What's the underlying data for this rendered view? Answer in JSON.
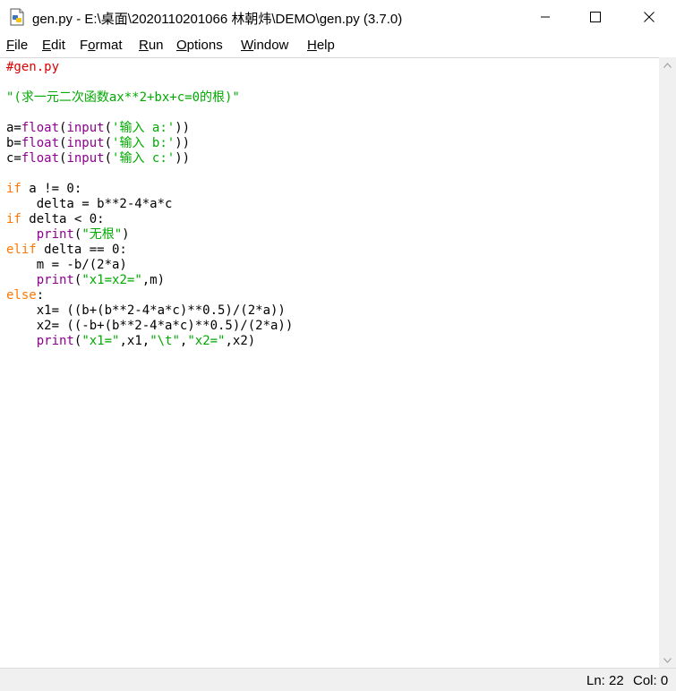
{
  "window": {
    "title": "gen.py - E:\\桌面\\2020110201066 林朝炜\\DEMO\\gen.py (3.7.0)",
    "icons": {
      "app": "python-file-icon",
      "minimize": "minimize-icon",
      "maximize": "maximize-icon",
      "close": "close-icon"
    }
  },
  "menu": {
    "file": {
      "u": "F",
      "rest": "ile"
    },
    "edit": {
      "u": "E",
      "rest": "dit"
    },
    "format": {
      "pre": "F",
      "u": "o",
      "rest": "rmat"
    },
    "run": {
      "u": "R",
      "rest": "un"
    },
    "options": {
      "u": "O",
      "rest": "ptions"
    },
    "window": {
      "u": "W",
      "rest": "indow"
    },
    "help": {
      "u": "H",
      "rest": "elp"
    }
  },
  "code": {
    "l1": "#gen.py",
    "l3": "\"(求一元二次函数ax**2+bx+c=0的根)\"",
    "l5": {
      "var": "a=",
      "fn1": "float",
      "p1": "(",
      "fn2": "input",
      "p2": "(",
      "str": "'输入 a:'",
      "p3": "))"
    },
    "l6": {
      "var": "b=",
      "fn1": "float",
      "p1": "(",
      "fn2": "input",
      "p2": "(",
      "str": "'输入 b:'",
      "p3": "))"
    },
    "l7": {
      "var": "c=",
      "fn1": "float",
      "p1": "(",
      "fn2": "input",
      "p2": "(",
      "str": "'输入 c:'",
      "p3": "))"
    },
    "l9": {
      "kw": "if",
      "rest": " a != 0:"
    },
    "l10": "    delta = b**2-4*a*c",
    "l11": {
      "kw": "if",
      "rest": " delta < 0:"
    },
    "l12": {
      "indent": "    ",
      "fn": "print",
      "p1": "(",
      "str": "\"无根\"",
      "p2": ")"
    },
    "l13": {
      "kw": "elif",
      "rest": " delta == 0:"
    },
    "l14": "    m = -b/(2*a)",
    "l15": {
      "indent": "    ",
      "fn": "print",
      "p1": "(",
      "str": "\"x1=x2=\"",
      "p2": ",m)"
    },
    "l16": {
      "kw": "else",
      "rest": ":"
    },
    "l17": "    x1= ((b+(b**2-4*a*c)**0.5)/(2*a))",
    "l18": "    x2= ((-b+(b**2-4*a*c)**0.5)/(2*a))",
    "l19": {
      "indent": "    ",
      "fn": "print",
      "p1": "(",
      "s1": "\"x1=\"",
      "m1": ",x1,",
      "s2": "\"\\t\"",
      "m2": ",",
      "s3": "\"x2=\"",
      "p2": ",x2)"
    }
  },
  "status": {
    "line": "Ln: 22",
    "col": "Col: 0"
  },
  "colors": {
    "keyword": "#ff7700",
    "builtin": "#900090",
    "string": "#00aa00",
    "comment": "#dd0000"
  }
}
